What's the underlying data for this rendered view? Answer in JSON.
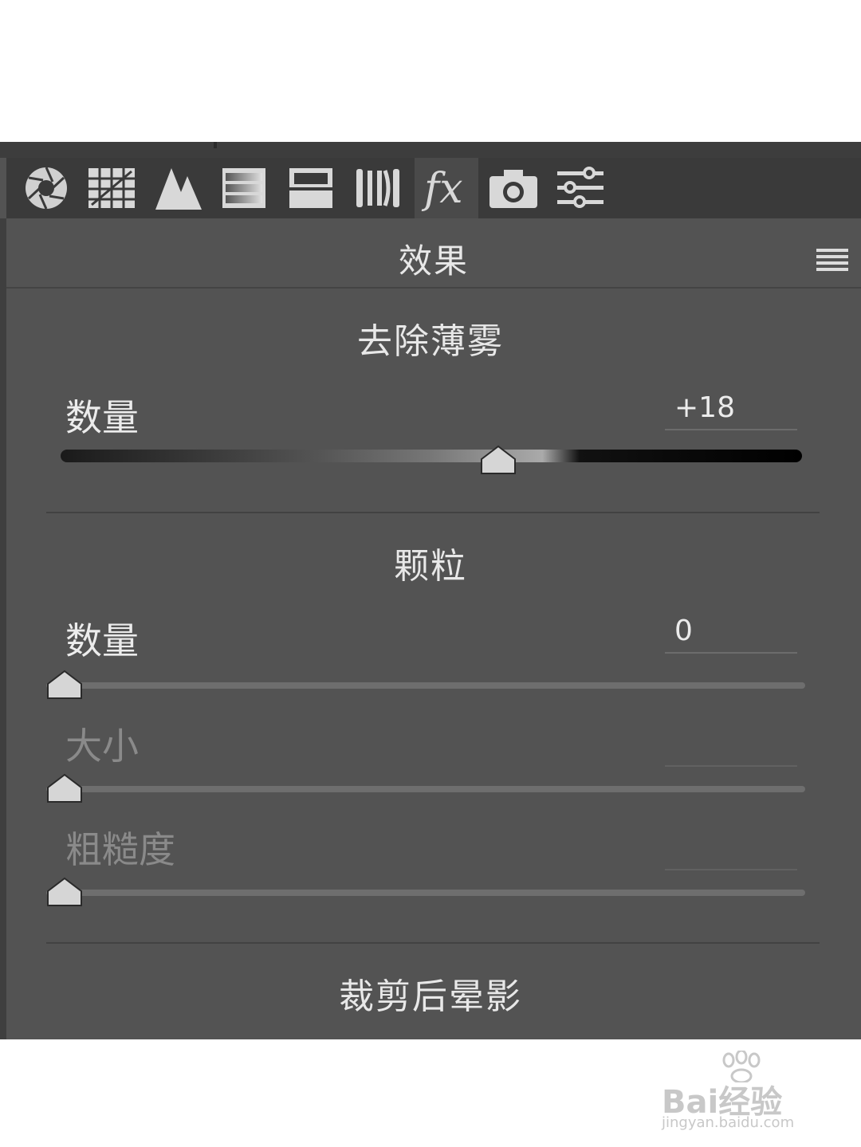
{
  "panel": {
    "title": "效果",
    "tabs": [
      {
        "name": "basic-aperture-icon",
        "active": false
      },
      {
        "name": "tone-curve-grid-icon",
        "active": false
      },
      {
        "name": "detail-mountain-icon",
        "active": false
      },
      {
        "name": "hsl-gradient-icon",
        "active": false
      },
      {
        "name": "split-toning-icon",
        "active": false
      },
      {
        "name": "lens-correction-icon",
        "active": false
      },
      {
        "name": "fx-effects-icon",
        "active": true
      },
      {
        "name": "camera-calibration-icon",
        "active": false
      },
      {
        "name": "presets-sliders-icon",
        "active": false
      }
    ],
    "menu_icon": "hamburger-menu-icon"
  },
  "dehaze": {
    "title": "去除薄雾",
    "amount_label": "数量",
    "amount_value": "+18",
    "slider_position": 0.59
  },
  "grain": {
    "title": "颗粒",
    "amount_label": "数量",
    "amount_value": "0",
    "size_label": "大小",
    "size_value": "",
    "roughness_label": "粗糙度",
    "roughness_value": ""
  },
  "vignette": {
    "title": "裁剪后晕影"
  },
  "watermark": {
    "brand": "Bai经验",
    "url": "jingyan.baidu.com"
  },
  "colors": {
    "panel_bg": "#535353",
    "toolbar_bg": "#3a3a3a",
    "text": "#e8e8e8",
    "dim_text": "#8a8a8a"
  }
}
